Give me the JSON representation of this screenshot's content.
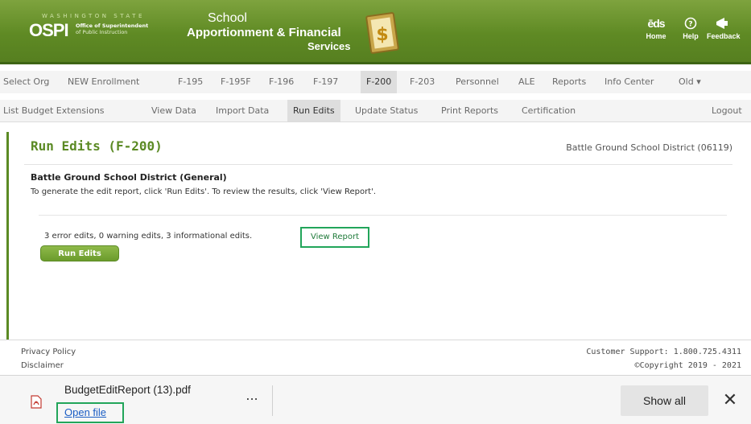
{
  "header": {
    "state_label": "WASHINGTON STATE",
    "logo_text": "OSPI",
    "logo_office_line1": "Office of Superintendent",
    "logo_office_line2": "of Public Instruction",
    "app_title_line1": "School",
    "app_title_line2": "Apportionment & Financial",
    "app_title_line3": "Services",
    "links": [
      {
        "icon": "eds-logo",
        "icon_text": "ēds",
        "label": "Home"
      },
      {
        "icon": "help-icon",
        "icon_text": "?",
        "label": "Help"
      },
      {
        "icon": "megaphone-icon",
        "icon_text": "◀",
        "label": "Feedback"
      }
    ]
  },
  "nav_primary": {
    "items": [
      "Select Org",
      "NEW Enrollment",
      "F-195",
      "F-195F",
      "F-196",
      "F-197",
      "F-200",
      "F-203",
      "Personnel",
      "ALE",
      "Reports",
      "Info Center",
      "Old ▾"
    ],
    "active": "F-200"
  },
  "nav_secondary": {
    "items": [
      "List Budget Extensions",
      "View Data",
      "Import Data",
      "Run Edits",
      "Update Status",
      "Print Reports",
      "Certification"
    ],
    "active": "Run Edits",
    "logout": "Logout"
  },
  "main": {
    "title": "Run Edits (F-200)",
    "district_right": "Battle Ground School District (06119)",
    "section_heading": "Battle Ground School District (General)",
    "instructions": "To generate the edit report, click 'Run Edits'. To review the results, click 'View Report'.",
    "summary": "3 error edits, 0 warning edits, 3 informational edits.",
    "view_report_label": "View Report",
    "run_edits_label": "Run Edits"
  },
  "footer": {
    "privacy": "Privacy Policy",
    "disclaimer": "Disclaimer",
    "support": "Customer Support: 1.800.725.4311",
    "copyright": "©Copyright 2019 - 2021"
  },
  "download_bar": {
    "filename": "BudgetEditReport (13).pdf",
    "open_file_label": "Open file",
    "more_label": "...",
    "show_all_label": "Show all",
    "close_label": "✕"
  },
  "colors": {
    "brand_green": "#5b8a24",
    "header_green": "#6b9631",
    "highlight_box": "#22a55a",
    "link_blue": "#1a5dc4"
  }
}
